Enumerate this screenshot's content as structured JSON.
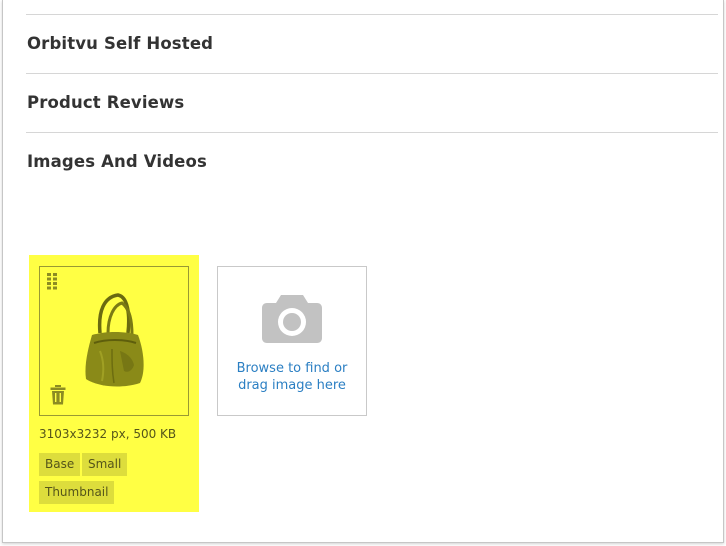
{
  "sections": [
    {
      "title": "Orbitvu Self Hosted"
    },
    {
      "title": "Product Reviews"
    },
    {
      "title": "Images And Videos"
    }
  ],
  "image": {
    "meta": "3103x3232 px, 500 KB",
    "roles": [
      "Base",
      "Small",
      "Thumbnail"
    ],
    "highlight_color": "#ffff44"
  },
  "upload": {
    "line1": "Browse to find or",
    "line2": "drag image here"
  },
  "icons": {
    "drag": "drag-handle-icon",
    "delete": "trash-icon",
    "placeholder": "camera-icon"
  },
  "colors": {
    "link": "#2b7fc3",
    "highlight": "#ffff44"
  }
}
